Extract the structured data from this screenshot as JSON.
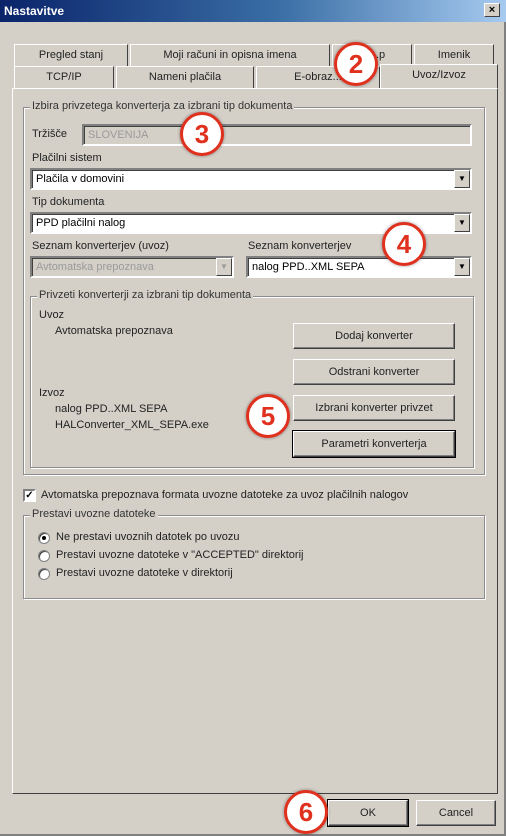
{
  "window": {
    "title": "Nastavitve",
    "close_glyph": "×"
  },
  "tabs_row1": [
    "Pregled stanj",
    "Moji računi in opisna imena",
    "E-...p",
    "Imenik"
  ],
  "tabs_row2": [
    "TCP/IP",
    "Nameni plačila",
    "E-obraz...",
    "Uvoz/Izvoz"
  ],
  "converter_group": {
    "label": "Izbira privzetega konverterja za izbrani tip dokumenta",
    "country_label": "Tržišče",
    "country_value": "SLOVENIJA",
    "payment_system_label": "Plačilni sistem",
    "payment_system_value": "Plačila v domovini",
    "doc_type_label": "Tip dokumenta",
    "doc_type_value": "PPD plačilni nalog",
    "import_list_label": "Seznam konverterjev (uvoz)",
    "import_list_value": "Avtomatska prepoznava",
    "export_list_label": "Seznam konverterjev",
    "export_list_value": "nalog PPD..XML SEPA"
  },
  "defaults_group": {
    "label": "Privzeti konverterji za izbrani tip dokumenta",
    "import_heading": "Uvoz",
    "import_value": "Avtomatska prepoznava",
    "export_heading": "Izvoz",
    "export_value": "nalog PPD..XML SEPA",
    "export_file": "HALConverter_XML_SEPA.exe",
    "btn_add": "Dodaj konverter",
    "btn_remove": "Odstrani konverter",
    "btn_default": "Izbrani konverter privzet",
    "btn_params": "Parametri konverterja"
  },
  "auto_detect": {
    "checked": true,
    "check_glyph": "✓",
    "label": "Avtomatska prepoznava formata uvozne datoteke za uvoz plačilnih nalogov"
  },
  "move_group": {
    "label": "Prestavi uvozne datoteke",
    "options": [
      "Ne prestavi uvoznih datotek po uvozu",
      "Prestavi uvozne datoteke v \"ACCEPTED\" direktorij",
      "Prestavi uvozne datoteke v direktorij"
    ],
    "selected": 0
  },
  "footer": {
    "ok": "OK",
    "cancel": "Cancel"
  },
  "markers": [
    "2",
    "3",
    "4",
    "5",
    "6"
  ],
  "colors": {
    "marker": "#e0301e",
    "title_start": "#0a246a",
    "face": "#d4d0c8"
  },
  "icons": {
    "dropdown": "▼"
  }
}
